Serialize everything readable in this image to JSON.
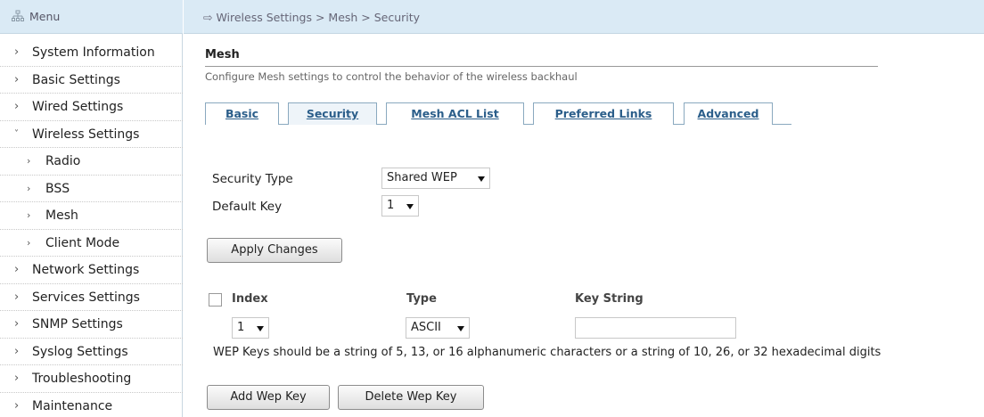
{
  "menu": {
    "title": "Menu",
    "icon": "sitemap-icon"
  },
  "sidebar": {
    "items": [
      {
        "label": "System Information",
        "level": 1
      },
      {
        "label": "Basic Settings",
        "level": 1
      },
      {
        "label": "Wired Settings",
        "level": 1
      },
      {
        "label": "Wireless Settings",
        "level": 1,
        "expanded": true
      },
      {
        "label": "Radio",
        "level": 2
      },
      {
        "label": "BSS",
        "level": 2
      },
      {
        "label": "Mesh",
        "level": 2,
        "selected": true
      },
      {
        "label": "Client Mode",
        "level": 2
      },
      {
        "label": "Network Settings",
        "level": 1
      },
      {
        "label": "Services Settings",
        "level": 1
      },
      {
        "label": "SNMP Settings",
        "level": 1
      },
      {
        "label": "Syslog Settings",
        "level": 1
      },
      {
        "label": "Troubleshooting",
        "level": 1
      },
      {
        "label": "Maintenance",
        "level": 1
      }
    ]
  },
  "breadcrumb": "⇨ Wireless Settings > Mesh > Security",
  "page": {
    "title": "Mesh",
    "description": "Configure Mesh settings to control the behavior of the wireless backhaul"
  },
  "tabs": [
    {
      "label": "Basic"
    },
    {
      "label": "Security",
      "active": true
    },
    {
      "label": "Mesh ACL List"
    },
    {
      "label": "Preferred Links"
    },
    {
      "label": "Advanced"
    }
  ],
  "form": {
    "security_type_label": "Security Type",
    "security_type_value": "Shared WEP",
    "default_key_label": "Default Key",
    "default_key_value": "1",
    "apply_button": "Apply Changes"
  },
  "table": {
    "headers": {
      "index": "Index",
      "type": "Type",
      "key_string": "Key String"
    },
    "row": {
      "index": "1",
      "type": "ASCII",
      "key_string": ""
    }
  },
  "hint": "WEP Keys should be a string of 5, 13, or 16 alphanumeric characters or a string of 10, 26, or 32 hexadecimal digits",
  "buttons": {
    "add": "Add Wep Key",
    "delete": "Delete Wep Key"
  },
  "colors": {
    "header_bg": "#daeaf5",
    "tab_text": "#2b5e8a"
  }
}
